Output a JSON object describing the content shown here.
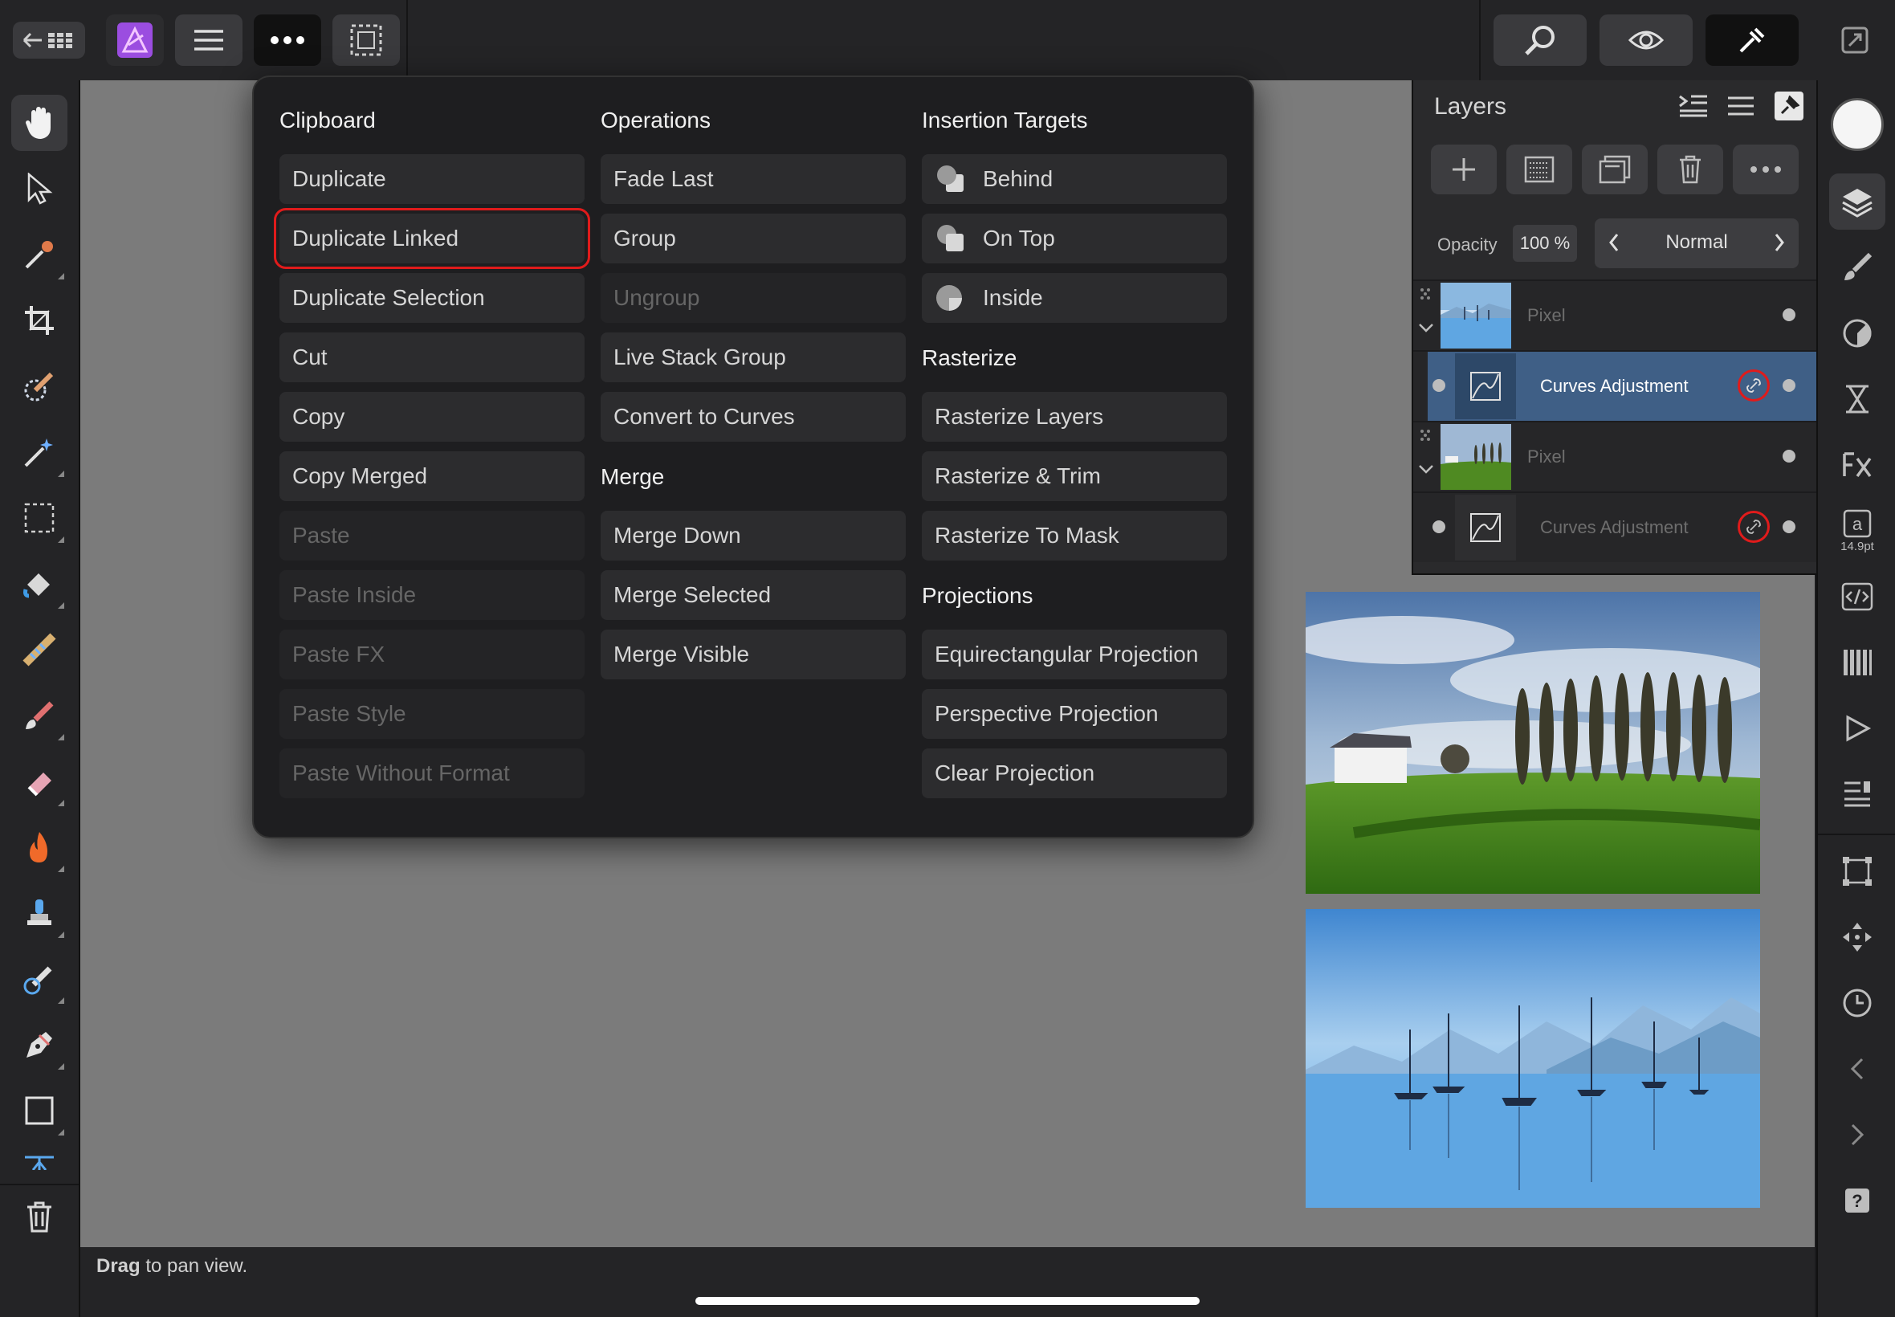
{
  "menu": {
    "clipboard": {
      "heading": "Clipboard",
      "items": [
        "Duplicate",
        "Duplicate Linked",
        "Duplicate Selection",
        "Cut",
        "Copy",
        "Copy Merged",
        "Paste",
        "Paste Inside",
        "Paste FX",
        "Paste Style",
        "Paste Without Format"
      ]
    },
    "operations": {
      "heading": "Operations",
      "items": [
        "Fade Last",
        "Group",
        "Ungroup",
        "Live Stack Group",
        "Convert to Curves"
      ]
    },
    "merge": {
      "heading": "Merge",
      "items": [
        "Merge Down",
        "Merge Selected",
        "Merge Visible"
      ]
    },
    "insertion_targets": {
      "heading": "Insertion Targets",
      "items": [
        "Behind",
        "On Top",
        "Inside"
      ]
    },
    "rasterize": {
      "heading": "Rasterize",
      "items": [
        "Rasterize Layers",
        "Rasterize & Trim",
        "Rasterize To Mask"
      ]
    },
    "projections": {
      "heading": "Projections",
      "items": [
        "Equirectangular Projection",
        "Perspective Projection",
        "Clear Projection"
      ]
    }
  },
  "layers": {
    "title": "Layers",
    "opacity_label": "Opacity",
    "opacity_value": "100 %",
    "blend_mode": "Normal",
    "rows": [
      {
        "name": "Pixel",
        "type": "pixel"
      },
      {
        "name": "Curves Adjustment",
        "type": "adjustment",
        "selected": true
      },
      {
        "name": "Pixel",
        "type": "pixel"
      },
      {
        "name": "Curves Adjustment",
        "type": "adjustment",
        "selected": false
      }
    ]
  },
  "right_tools": {
    "text_size": "14.9pt"
  },
  "status": {
    "bold": "Drag",
    "rest": " to pan view."
  },
  "colors": {
    "highlight": "#e01b1b",
    "selected_layer": "#3f5f86",
    "app_icon": "#9b4de0"
  }
}
